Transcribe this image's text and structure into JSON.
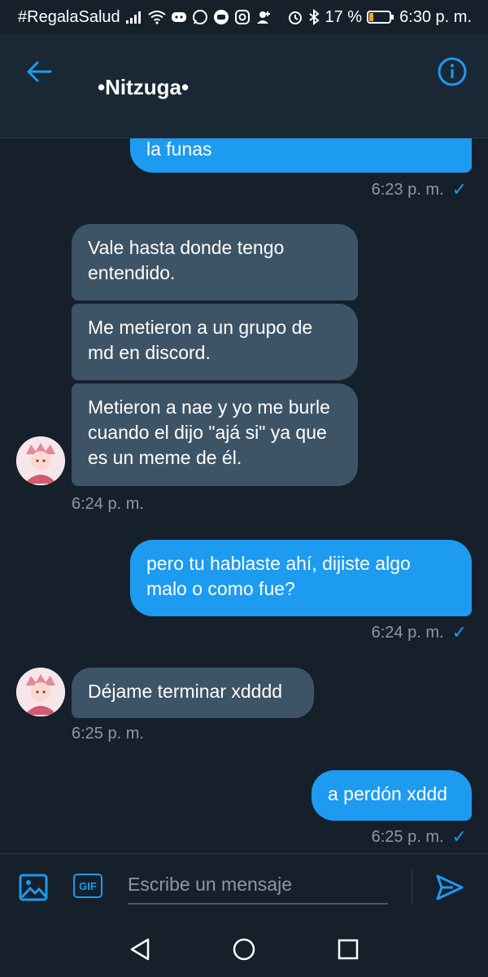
{
  "status_bar": {
    "carrier": "#RegalaSalud",
    "battery": "17 %",
    "time": "6:30 p. m."
  },
  "header": {
    "title": "•Nitzuga•"
  },
  "messages": [
    {
      "direction": "out",
      "text": "la funas",
      "time": "6:23 p. m.",
      "read_mark": "✓"
    },
    {
      "direction": "in",
      "text": "Vale hasta donde tengo entendido."
    },
    {
      "direction": "in",
      "text": "Me metieron a un grupo de md en discord."
    },
    {
      "direction": "in",
      "text": "Metieron a nae y yo me burle cuando el dijo \"ajá si\" ya que es un meme de él.",
      "time": "6:24 p. m."
    },
    {
      "direction": "out",
      "text": "pero tu hablaste ahí, dijiste algo malo o como fue?",
      "time": "6:24 p. m.",
      "read_mark": "✓"
    },
    {
      "direction": "in",
      "text": "Déjame terminar xdddd",
      "time": "6:25 p. m."
    },
    {
      "direction": "out",
      "text": "a perdón xddd",
      "time": "6:25 p. m.",
      "read_mark": "✓"
    }
  ],
  "composer": {
    "placeholder": "Escribe un mensaje",
    "gif_label": "GIF"
  },
  "icons": {
    "back": "arrow-left-icon",
    "info": "info-icon",
    "image": "image-icon",
    "gif": "gif-icon",
    "send": "send-icon",
    "nav_back": "triangle-back-icon",
    "nav_home": "circle-home-icon",
    "nav_recent": "square-recent-icon"
  },
  "colors": {
    "background": "#15202b",
    "header": "#1a2836",
    "accent": "#1d9bf0",
    "incoming_bubble": "#3d5466",
    "muted_text": "#8b98a5"
  }
}
